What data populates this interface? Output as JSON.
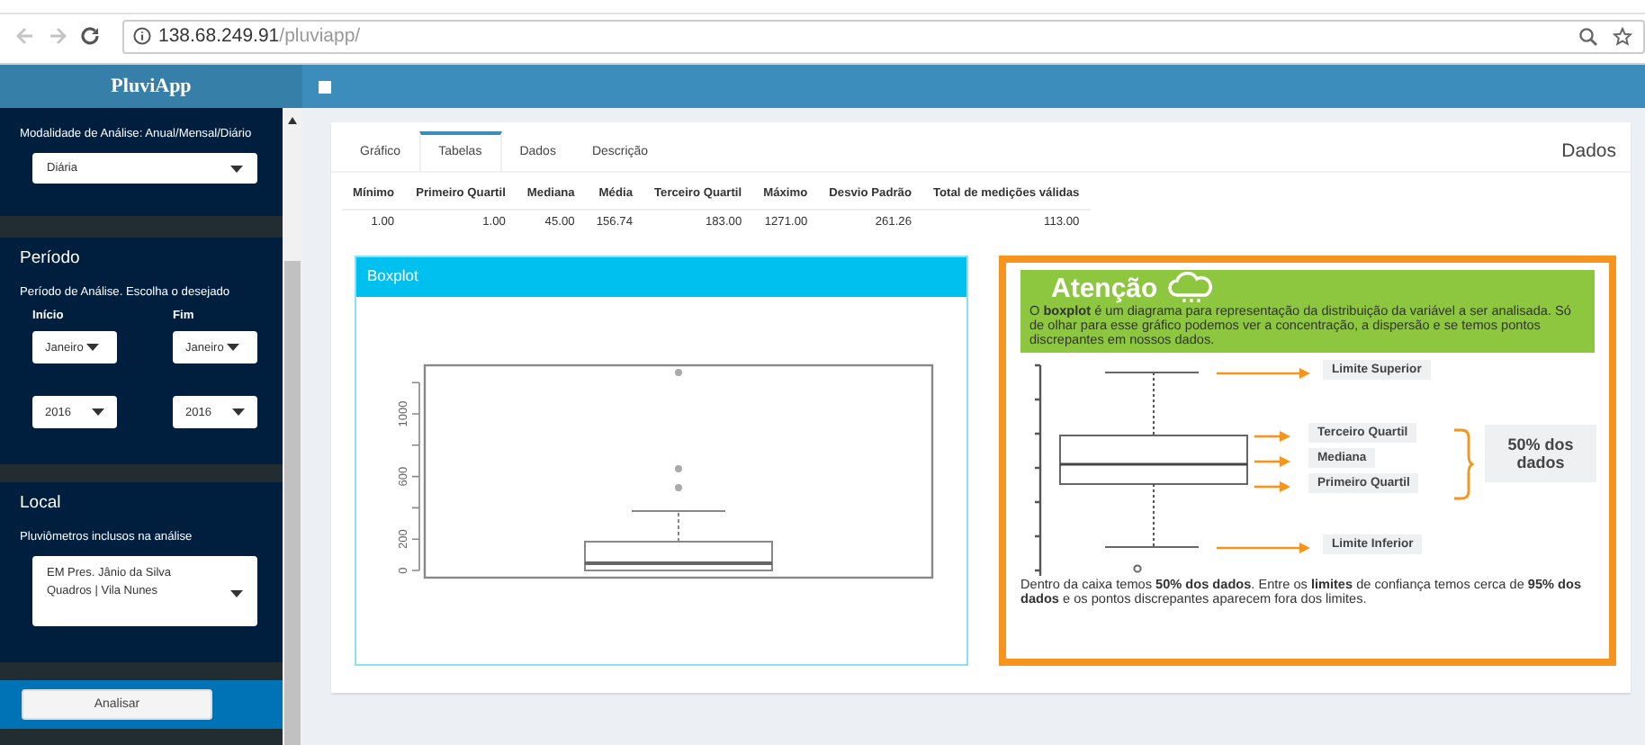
{
  "browser": {
    "url_host": "138.68.249.91",
    "url_path": "/pluviapp/"
  },
  "app": {
    "title": "PluviApp"
  },
  "sidebar": {
    "mode": {
      "label": "Modalidade de Análise: Anual/Mensal/Diário",
      "value": "Diária"
    },
    "period": {
      "title": "Período",
      "subtitle": "Período de Análise. Escolha o desejado",
      "start": {
        "label": "Início",
        "month": "Janeiro",
        "year": "2016"
      },
      "end": {
        "label": "Fim",
        "month": "Janeiro",
        "year": "2016"
      }
    },
    "location": {
      "title": "Local",
      "subtitle": "Pluviômetros inclusos na análise",
      "value": "EM Pres. Jânio da Silva Quadros | Vila Nunes"
    },
    "button": "Analisar"
  },
  "tabs": [
    {
      "label": "Gráfico",
      "selected": false
    },
    {
      "label": "Tabelas",
      "selected": true
    },
    {
      "label": "Dados",
      "selected": false
    },
    {
      "label": "Descrição",
      "selected": false
    }
  ],
  "panel_title": "Dados",
  "table": {
    "columns": [
      "Mínimo",
      "Primeiro Quartil",
      "Mediana",
      "Média",
      "Terceiro Quartil",
      "Máximo",
      "Desvio Padrão",
      "Total de medições válidas"
    ],
    "rows": [
      [
        "1.00",
        "1.00",
        "45.00",
        "156.74",
        "183.00",
        "1271.00",
        "261.26",
        "113.00"
      ]
    ]
  },
  "boxplot": {
    "title": "Boxplot",
    "y_tick_labels": [
      "0",
      "200",
      "600",
      "1000"
    ]
  },
  "attention": {
    "title": "Atenção",
    "intro": "O **boxplot** é um diagrama para representação da distribuição da variável a ser analisada. Só de olhar para esse gráfico podemos ver a concentração, a dispersão e se temos pontos discrepantes em nossos dados.",
    "callouts": [
      "Limite Superior",
      "Terceiro Quartil",
      "Mediana",
      "Primeiro Quartil",
      "Limite Inferior"
    ],
    "share": "50% dos dados",
    "note": "Dentro da caixa temos **50% dos dados**. Entre os **limites** de confiança temos cerca de **95% dos dados** e os pontos discrepantes aparecem fora dos limites."
  }
}
